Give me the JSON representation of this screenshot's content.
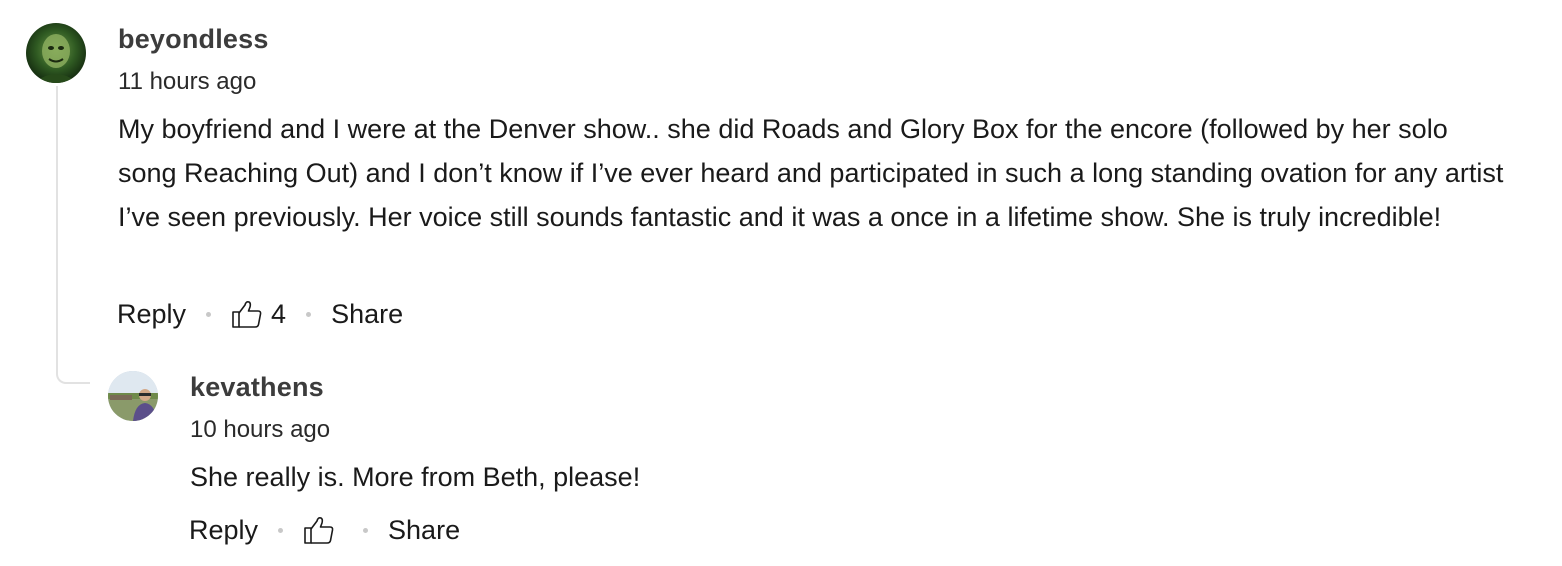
{
  "comments": [
    {
      "username": "beyondless",
      "timestamp": "11 hours ago",
      "body": "My boyfriend and I were at the Denver show.. she did Roads and Glory Box for the encore (followed by her solo song Reaching Out) and I don’t know if I’ve ever heard and participated in such a long standing ovation for any artist I’ve seen previously. Her voice still sounds fantastic and it was a once in a lifetime show. She is truly incredible!",
      "reply_label": "Reply",
      "like_count": "4",
      "share_label": "Share",
      "avatar_icon": "user-avatar-green-portrait"
    },
    {
      "username": "kevathens",
      "timestamp": "10 hours ago",
      "body": "She really is. More from Beth, please!",
      "reply_label": "Reply",
      "like_count": "",
      "share_label": "Share",
      "avatar_icon": "user-avatar-outdoor-photo"
    }
  ],
  "icons": {
    "like": "thumbs-up-icon"
  },
  "colors": {
    "username": "#3c3c3c",
    "text": "#1a1a1a",
    "separator": "#c8c8c8",
    "thread_line": "#e2e2e2"
  }
}
